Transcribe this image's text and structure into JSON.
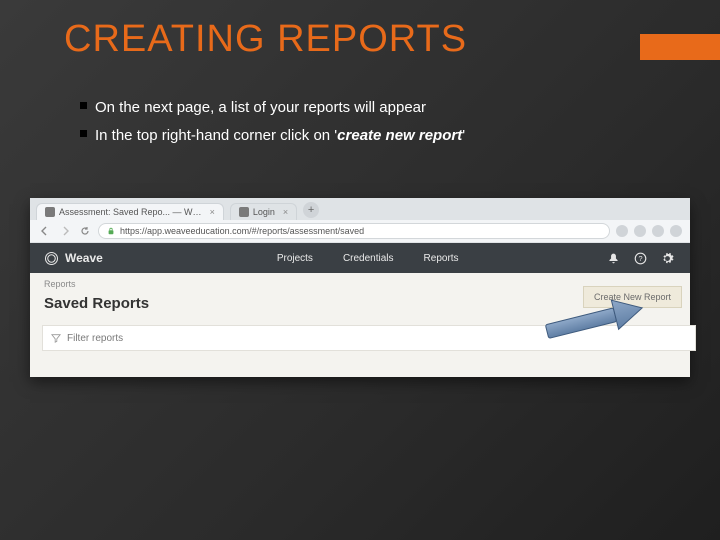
{
  "title": "CREATING REPORTS",
  "bullets": {
    "line1": "On the next page, a list of your reports will appear",
    "line2_a": "In the top right-hand corner click on '",
    "line2_em": "create new report",
    "line2_b": "'"
  },
  "browser": {
    "tab1": "Assessment: Saved Repo... — W…",
    "tab2": "Login",
    "url": "https://app.weaveeducation.com/#/reports/assessment/saved"
  },
  "app": {
    "brand": "Weave",
    "nav": {
      "projects": "Projects",
      "credentials": "Credentials",
      "reports": "Reports"
    },
    "crumbs": "Reports",
    "heading": "Saved Reports",
    "filter_placeholder": "Filter reports",
    "create_label": "Create New Report"
  },
  "colors": {
    "accent": "#e86a1a"
  }
}
